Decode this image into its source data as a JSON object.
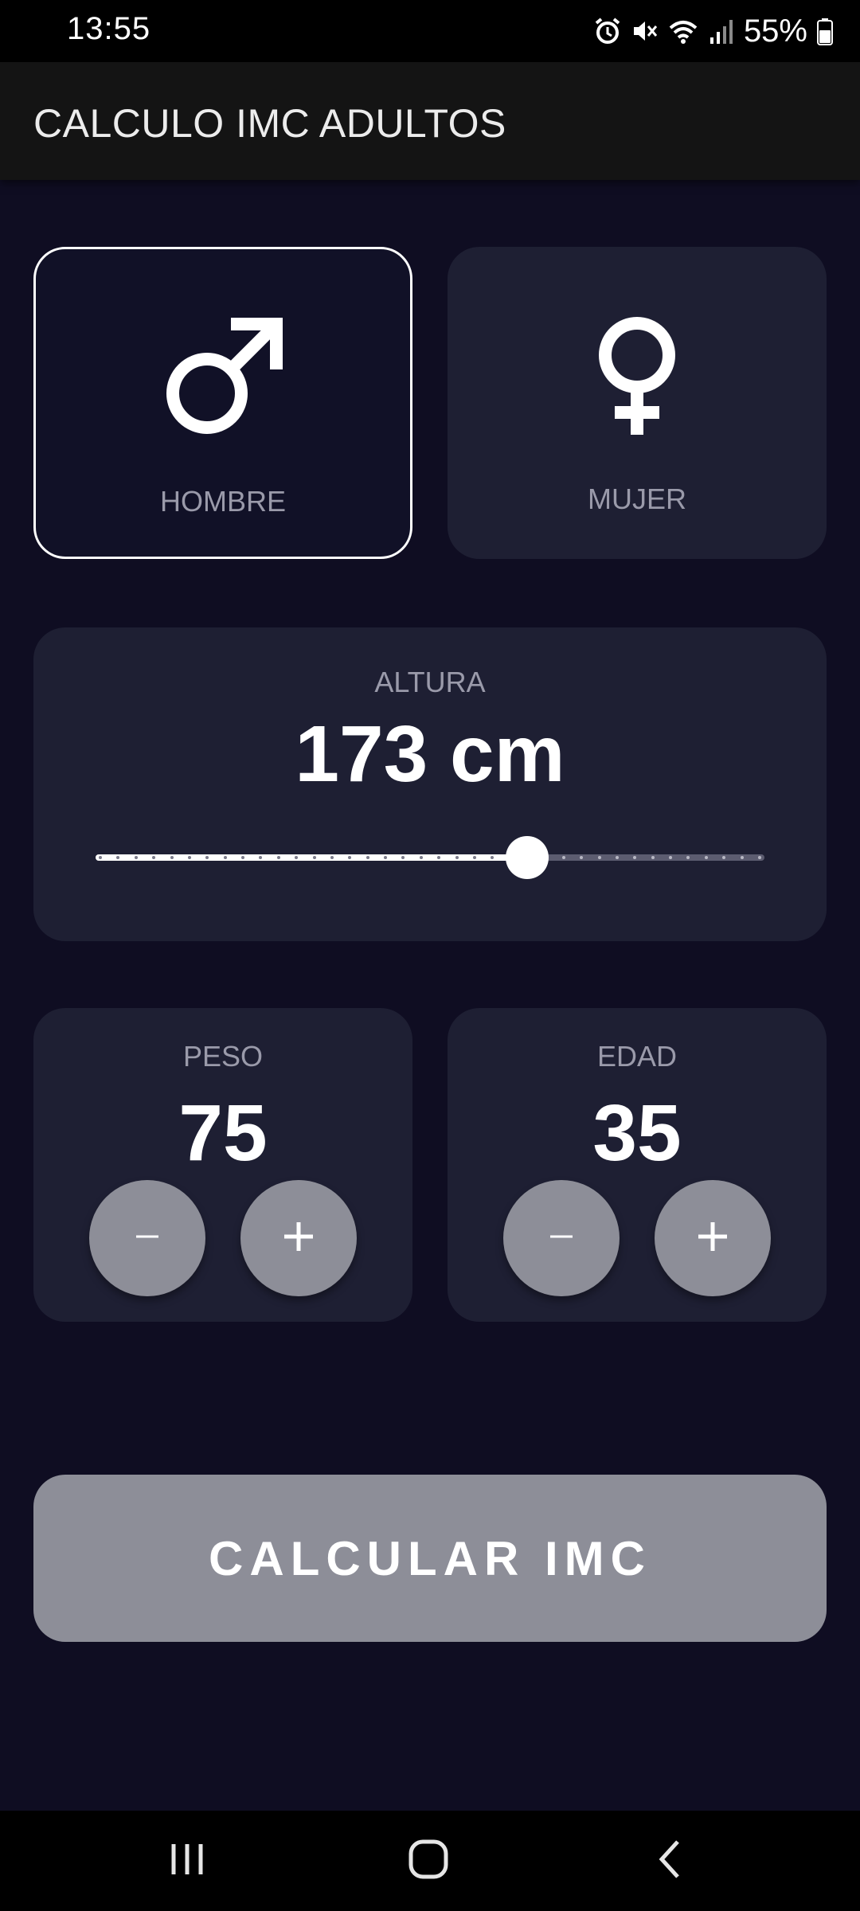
{
  "status_bar": {
    "time": "13:55",
    "battery": "55%",
    "icons": [
      "alarm-icon",
      "mute-icon",
      "wifi-icon",
      "signal-icon",
      "battery-icon"
    ]
  },
  "app_bar": {
    "title": "CALCULO IMC ADULTOS"
  },
  "gender": {
    "selected": "male",
    "options": [
      {
        "id": "male",
        "label": "HOMBRE",
        "icon": "male-symbol-icon"
      },
      {
        "id": "female",
        "label": "MUJER",
        "icon": "female-symbol-icon"
      }
    ]
  },
  "height": {
    "label": "ALTURA",
    "value_text": "173 cm",
    "slider_fraction": 0.645
  },
  "weight": {
    "label": "PESO",
    "value": "75",
    "decrement_label": "−",
    "increment_label": "+"
  },
  "age": {
    "label": "EDAD",
    "value": "35",
    "decrement_label": "−",
    "increment_label": "+"
  },
  "calculate_button": {
    "label": "CALCULAR IMC"
  },
  "nav_bar": {
    "buttons": [
      "recents-icon",
      "home-icon",
      "back-icon"
    ]
  },
  "colors": {
    "background": "#0f0d22",
    "card": "#1e1f33",
    "selected_card": "#111127",
    "button_gray": "#8d8e98",
    "label_gray": "#9a9aaa"
  }
}
